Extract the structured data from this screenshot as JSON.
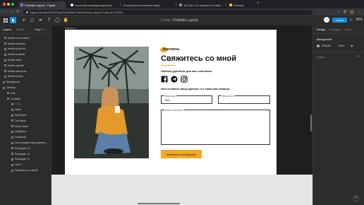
{
  "browser": {
    "tabs": [
      {
        "title": "Portfolio Layout – Figma",
        "favicon_color": "#a259ff",
        "active": true
      },
      {
        "title": "политика конфиденциально...",
        "favicon_color": "#f0f0f0",
        "active": false
      },
      {
        "title": "Конструктор политики конф...",
        "favicon_color": "#9aa0a6",
        "active": false
      },
      {
        "title": "182 ФЗ. Что сделать на сайт...",
        "favicon_color": "#9aa0a6",
        "active": false
      },
      {
        "title": "Portfolio",
        "favicon_color": "#f5c518",
        "active": false
      }
    ],
    "url": "figma.com/file/3G96F3rgLPkDhhht0TxdbPortfolio-Layout?node-id=0%3A1"
  },
  "toolbar": {
    "project": "Drafts",
    "separator": "/",
    "file_name": "Portfolio Layout",
    "file_menu": "⌄",
    "share_label": "Share",
    "zoom": "36%"
  },
  "left_panel": {
    "tab_layers": "Layers",
    "tab_assets": "Assets",
    "pages_label": "Page 1 ⌄",
    "layers": [
      {
        "name": "Mobile menu active",
        "dim": false
      },
      {
        "name": "Mobile contacts",
        "dim": false
      },
      {
        "name": "Mobile price list",
        "dim": false
      },
      {
        "name": "Mobile portfolio",
        "dim": false
      },
      {
        "name": "Mobile skills",
        "dim": false
      },
      {
        "name": "Mobile benefit",
        "dim": false
      },
      {
        "name": "Mobile about me",
        "dim": false
      },
      {
        "name": "Mobile promo",
        "dim": false
      },
      {
        "name": "Background",
        "dim": false
      },
      {
        "name": "Desktop",
        "dim": false
      },
      {
        "name": "Grid",
        "dim": false
      },
      {
        "name": "Contacts",
        "dim": false
      },
      {
        "name": "Policy",
        "dim": true
      },
      {
        "name": "Mask",
        "dim": false
      },
      {
        "name": "Mail block",
        "dim": false
      },
      {
        "name": "Text block",
        "dim": false
      },
      {
        "name": "Name block",
        "dim": false
      },
      {
        "name": "Instagram",
        "dim": false
      },
      {
        "name": "Facebook",
        "dim": false
      },
      {
        "name": "Или оставьте ваши данны...",
        "dim": false
      },
      {
        "name": "Rectangle 12",
        "dim": false
      },
      {
        "name": "Rectangle 13",
        "dim": false
      },
      {
        "name": "Rectangle 11",
        "dim": false
      },
      {
        "name": "Line 2",
        "dim": false
      },
      {
        "name": "Свяжитесь со мной",
        "dim": false
      }
    ]
  },
  "canvas": {
    "frame_label": "Desktop"
  },
  "design": {
    "tag": "Контакты",
    "headline": "Свяжитесь со мной",
    "subline": "Любым удобным для вас способом:",
    "ask": "Или оставьте ваши данные и я сама вам напишу:",
    "field_name_label": "Ваше имя",
    "field_name_value": "Имя",
    "field_contact_label": "Ваша почта",
    "field_message_label": "Ваше сообщение",
    "button_label": "Отправить сообщение",
    "accent": "#f5a623"
  },
  "right_panel": {
    "tab_design": "Design",
    "tab_prototype": "Prototype",
    "tab_code": "Code",
    "background_label": "Background",
    "background_hex": "E5E5E5",
    "background_opacity": "100%",
    "export_label": "Export"
  }
}
